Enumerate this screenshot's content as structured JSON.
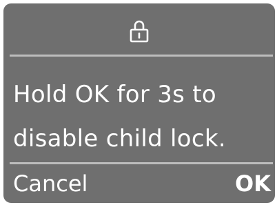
{
  "dialog": {
    "icon": "lock-icon",
    "message_line1": "Hold OK for 3s to",
    "message_line2": "disable child lock.",
    "cancel_label": "Cancel",
    "ok_label": "OK"
  },
  "colors": {
    "dialog_background": "#6f6f6f",
    "divider": "#bdbdbd",
    "text": "#ffffff"
  }
}
